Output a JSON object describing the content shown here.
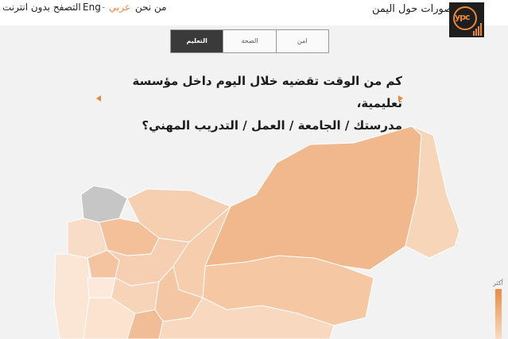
{
  "header": {
    "site_title": "تصورات حول اليمن",
    "logo_text": "ypc",
    "about_link": "من نحن",
    "lang_arabic": "عربي",
    "lang_separator": "-",
    "lang_english": "Eng",
    "offline_link": "التصفح بدون انترنت"
  },
  "tabs": [
    {
      "label": "امن",
      "active": false
    },
    {
      "label": "الصحة",
      "active": false
    },
    {
      "label": "التعليم",
      "active": true
    }
  ],
  "question": {
    "line1": "كم من الوقت تقضيه خلال اليوم داخل مؤسسة تعليمية،",
    "line2": "مدرستك / الجامعة / العمل / التدريب المهني؟"
  },
  "legend": {
    "high_label": "أكثر"
  },
  "colors": {
    "accent": "#e9873a",
    "active_tab": "#3a3a3a",
    "no_data": "#c6c6c6"
  },
  "map_regions": [
    {
      "name": "hadramaut",
      "shade": "#f2b88d"
    },
    {
      "name": "al-mahra",
      "shade": "#f7d5b9"
    },
    {
      "name": "shabwa",
      "shade": "#f5c7a3"
    },
    {
      "name": "marib",
      "shade": "#f6cdad"
    },
    {
      "name": "al-jawf",
      "shade": "#f6cfb1"
    },
    {
      "name": "saada",
      "shade": "#c6c6c6"
    },
    {
      "name": "amran",
      "shade": "#f3c09a"
    },
    {
      "name": "hajjah",
      "shade": "#f8dcc7"
    },
    {
      "name": "hodeidah",
      "shade": "#fbe6d6"
    },
    {
      "name": "sanaa",
      "shade": "#f6cfb2"
    },
    {
      "name": "mahwit",
      "shade": "#f4c4a0"
    },
    {
      "name": "raymah",
      "shade": "#fde9dc"
    },
    {
      "name": "dhamar",
      "shade": "#f7d3b7"
    },
    {
      "name": "ibb",
      "shade": "#fbe3d0"
    },
    {
      "name": "bayda",
      "shade": "#f4c6a3"
    },
    {
      "name": "abyan",
      "shade": "#f8d8bf"
    },
    {
      "name": "taiz",
      "shade": "#f3c7a6"
    },
    {
      "name": "lahj",
      "shade": "#fae0cb"
    },
    {
      "name": "dhale",
      "shade": "#f1bd96"
    }
  ]
}
